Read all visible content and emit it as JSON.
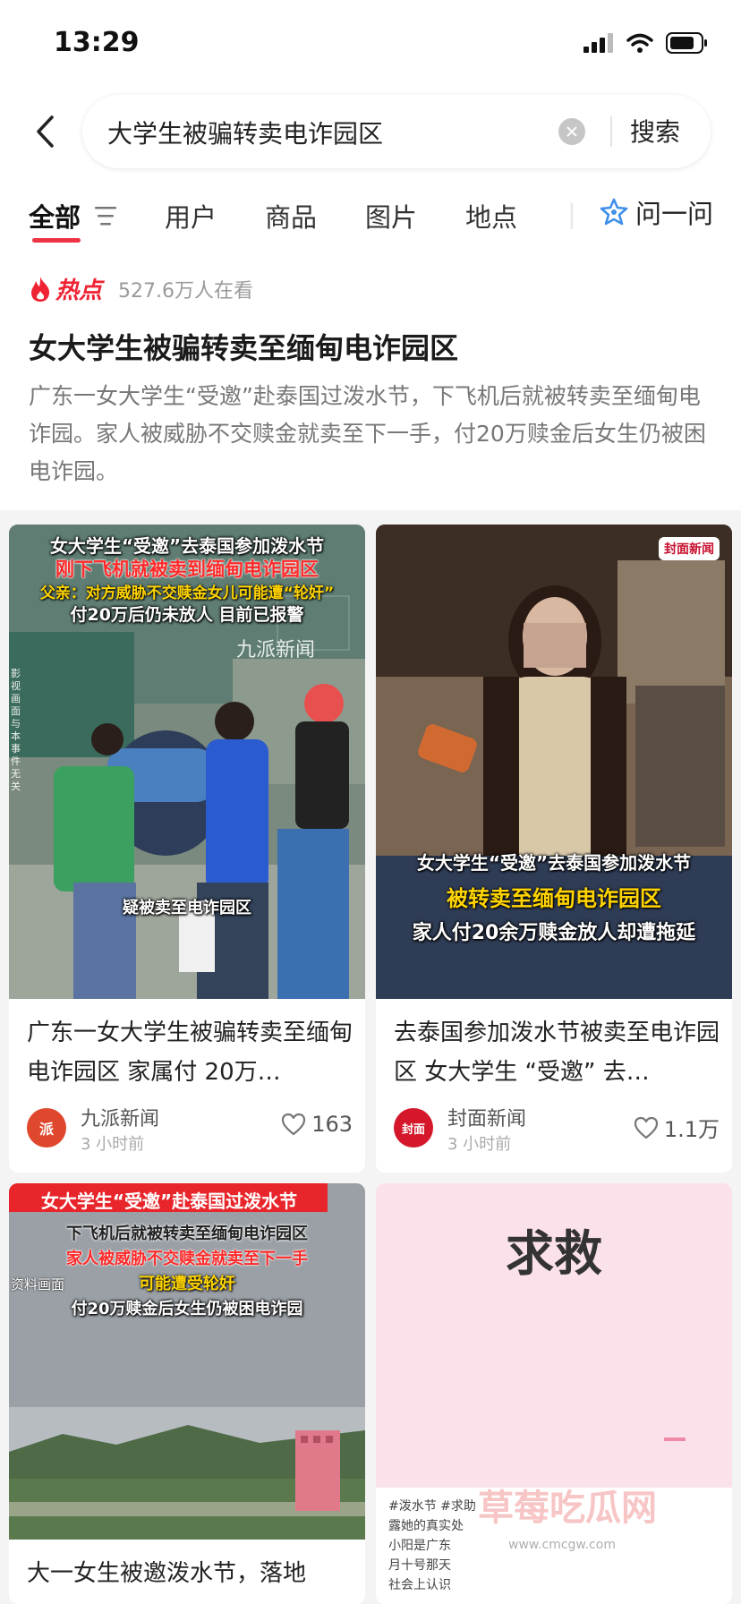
{
  "status": {
    "time": "13:29"
  },
  "search": {
    "query": "大学生被骗转卖电诈园区",
    "button": "搜索"
  },
  "tabs": {
    "items": [
      "全部",
      "用户",
      "商品",
      "图片",
      "地点"
    ],
    "ask": "问一问"
  },
  "hot": {
    "label": "热点",
    "count": "527.6万人在看",
    "title": "女大学生被骗转卖至缅甸电诈园区",
    "desc": "广东一女大学生“受邀”赴泰国过泼水节，下飞机后就被转卖至缅甸电诈园。家人被威胁不交赎金就卖至下一手，付20万赎金后女生仍被困电诈园。"
  },
  "cards": [
    {
      "thumb_captions": [
        "女大学生“受邀”去泰国参加泼水节",
        "刚下飞机就被卖到缅甸电诈园区",
        "父亲：对方威胁不交赎金女儿可能遭“轮奸”",
        "付20万后仍未放人 目前已报警"
      ],
      "thumb_watermark": "九派新闻",
      "thumb_side_note": "影视画面与本事件无关",
      "thumb_subtitle": "疑被卖至电诈园区",
      "title": "广东一女大学生被骗转卖至缅甸电诈园区 家属付 20万…",
      "source": "九派新闻",
      "avatar_text": "派",
      "time": "3 小时前",
      "likes": "163"
    },
    {
      "thumb_captions": [
        "女大学生“受邀”去泰国参加泼水节",
        "被转卖至缅甸电诈园区",
        "家人付20余万赎金放人却遭拖延"
      ],
      "thumb_badge": "封面新闻",
      "title": "去泰国参加泼水节被卖至电诈园区 女大学生 “受邀” 去…",
      "source": "封面新闻",
      "avatar_text": "封面",
      "time": "3 小时前",
      "likes": "1.1万"
    },
    {
      "thumb_captions": [
        "女大学生“受邀”赴泰国过泼水节",
        "下飞机后就被转卖至缅甸电诈园区",
        "家人被威胁不交赎金就卖至下一手",
        "可能遭受轮奸",
        "付20万赎金后女生仍被困电诈园"
      ],
      "thumb_note": "资料画面",
      "title": "大一女生被邀泼水节，落地"
    },
    {
      "big_text": "求救",
      "snippet": [
        "#泼水节 #求助",
        "露她的真实处",
        "小阳是广东",
        "月十号那天",
        "社会上认识"
      ]
    }
  ],
  "watermark": {
    "text": "草莓吃瓜网",
    "url": "www.cmcgw.com"
  },
  "colors": {
    "accent": "#ee3344",
    "hot": "#ee2233"
  }
}
